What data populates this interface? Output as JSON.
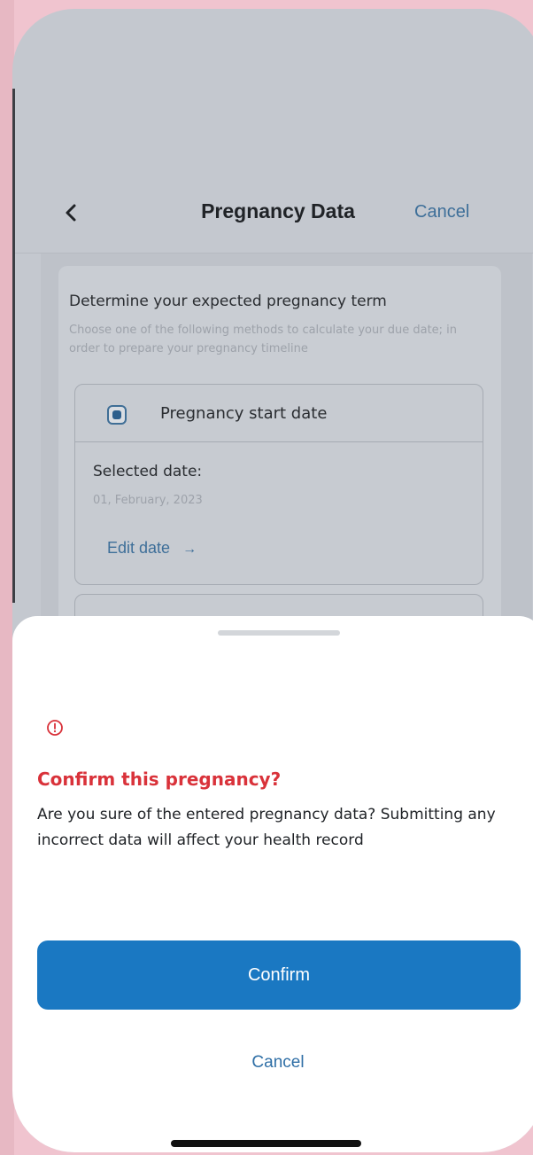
{
  "header": {
    "title": "Pregnancy Data",
    "cancel_label": "Cancel"
  },
  "card": {
    "title": "Determine your expected pregnancy term",
    "subtitle": "Choose one of the following methods to calculate your due date; in order to prepare your pregnancy timeline",
    "option": {
      "label": "Pregnancy start date",
      "selected": true,
      "selected_label": "Selected date:",
      "selected_value": "01, February, 2023",
      "edit_label": "Edit date",
      "edit_arrow": "→"
    }
  },
  "sheet": {
    "icon": "alert-circle-icon",
    "title": "Confirm this pregnancy?",
    "body": "Are you sure of the entered pregnancy data? Submitting any incorrect data will affect your health record",
    "confirm_label": "Confirm",
    "cancel_label": "Cancel"
  },
  "colors": {
    "accent": "#1a78c2",
    "danger": "#d9323a",
    "link": "#2f6fa6"
  }
}
